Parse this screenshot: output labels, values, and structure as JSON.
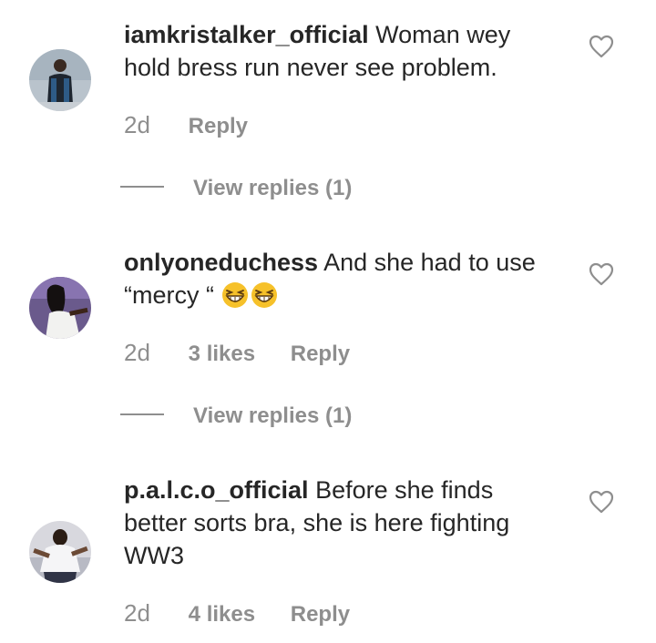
{
  "comments": [
    {
      "username": "iamkristalker_official",
      "text": "Woman wey hold bress run never see problem.",
      "time": "2d",
      "likes": "",
      "reply_label": "Reply",
      "view_replies": "View replies (1)"
    },
    {
      "username": "onlyoneduchess",
      "text": "And she had to use “mercy “",
      "emojis": [
        "grinning-squinting-face-emoji",
        "grinning-squinting-face-emoji"
      ],
      "time": "2d",
      "likes": "3 likes",
      "reply_label": "Reply",
      "view_replies": "View replies (1)"
    },
    {
      "username": "p.a.l.c.o_official",
      "text": "Before she finds better sorts bra, she is here fighting WW3",
      "time": "2d",
      "likes": "4 likes",
      "reply_label": "Reply"
    }
  ],
  "icons": {
    "like": "heart-outline-icon"
  },
  "colors": {
    "text": "#262626",
    "secondary": "#8e8e8e",
    "background": "#ffffff"
  }
}
